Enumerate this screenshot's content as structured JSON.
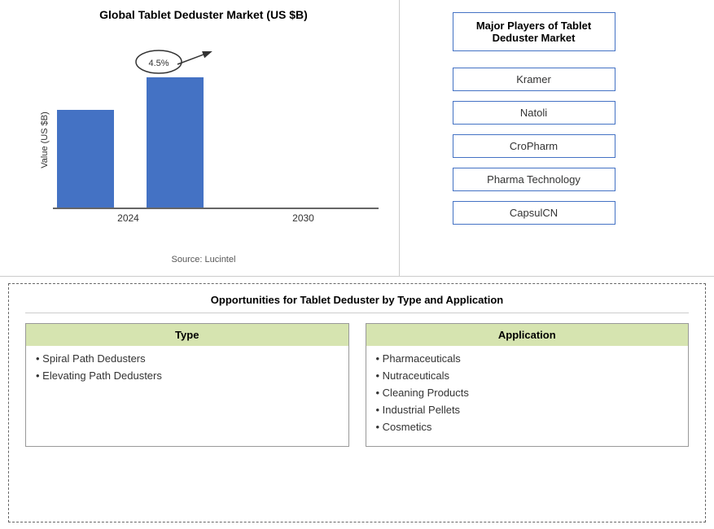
{
  "chart": {
    "title": "Global Tablet Deduster Market (US $B)",
    "y_axis_label": "Value (US $B)",
    "source": "Source: Lucintel",
    "annotation": "4.5%",
    "bars": [
      {
        "year": "2024",
        "height": 120
      },
      {
        "year": "2030",
        "height": 160
      }
    ]
  },
  "players": {
    "title": "Major Players of Tablet\nDeduster Market",
    "items": [
      "Kramer",
      "Natoli",
      "CroPharm",
      "Pharma Technology",
      "CapsulCN"
    ]
  },
  "opportunities": {
    "title": "Opportunities for Tablet Deduster by Type and Application",
    "type": {
      "header": "Type",
      "items": [
        "Spiral Path Dedusters",
        "Elevating Path Dedusters"
      ]
    },
    "application": {
      "header": "Application",
      "items": [
        "Pharmaceuticals",
        "Nutraceuticals",
        "Cleaning Products",
        "Industrial Pellets",
        "Cosmetics"
      ]
    }
  }
}
